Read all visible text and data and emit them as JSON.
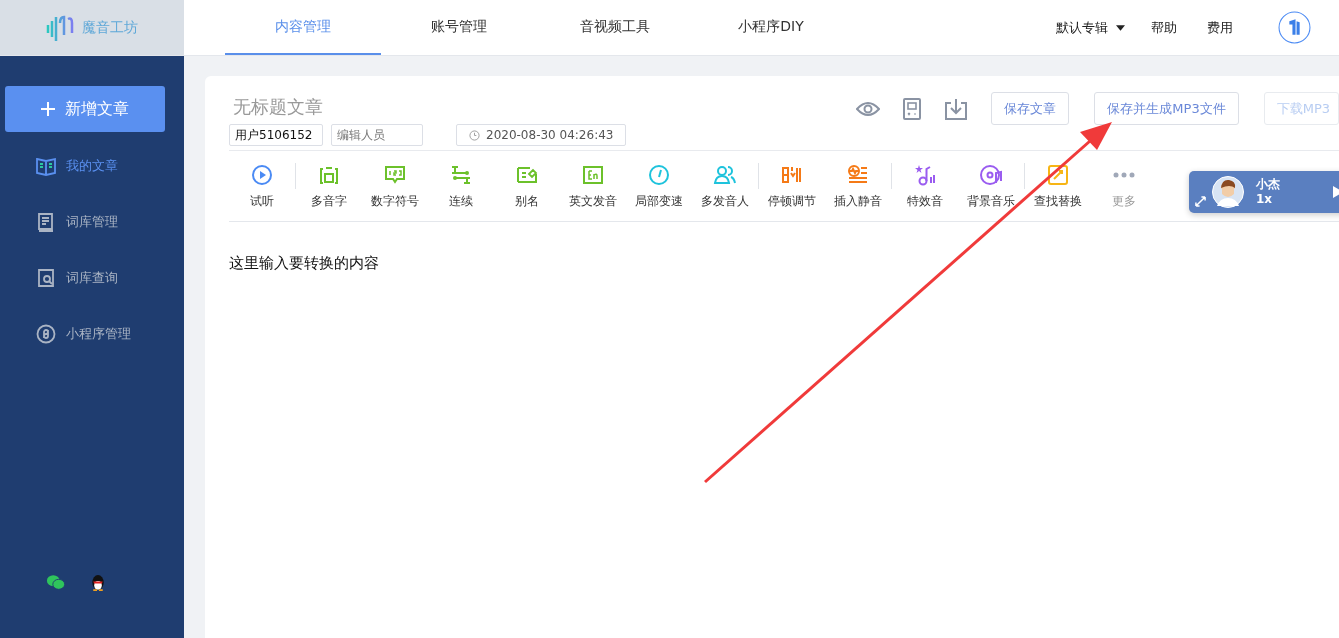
{
  "logo": {
    "text": "魔音工坊"
  },
  "nav_tabs": [
    {
      "label": "内容管理",
      "selected": true
    },
    {
      "label": "账号管理",
      "selected": false
    },
    {
      "label": "音视频工具",
      "selected": false
    },
    {
      "label": "小程序DIY",
      "selected": false
    }
  ],
  "header_right": {
    "album": "默认专辑",
    "links": [
      "帮助",
      "费用"
    ]
  },
  "sidebar": {
    "new_button": "新增文章",
    "items": [
      {
        "label": "我的文章",
        "selected": true
      },
      {
        "label": "词库管理",
        "selected": false
      },
      {
        "label": "词库查询",
        "selected": false
      },
      {
        "label": "小程序管理",
        "selected": false
      }
    ]
  },
  "article": {
    "title_placeholder": "无标题文章",
    "author": "用户5106152",
    "editor_placeholder": "编辑人员",
    "date": "2020-08-30 04:26:43",
    "buttons": [
      {
        "label": "保存文章",
        "disabled": false
      },
      {
        "label": "保存并生成MP3文件",
        "disabled": false
      },
      {
        "label": "下载MP3",
        "disabled": true
      }
    ]
  },
  "tool_groups": [
    {
      "tools": [
        {
          "label": "试听",
          "color": "#4a8af4"
        }
      ]
    },
    {
      "tools": [
        {
          "label": "多音字",
          "color": "#6cc12b"
        },
        {
          "label": "数字符号",
          "color": "#6cc12b"
        },
        {
          "label": "连续",
          "color": "#6cc12b"
        },
        {
          "label": "别名",
          "color": "#6cc12b"
        },
        {
          "label": "英文发音",
          "color": "#6cc12b"
        },
        {
          "label": "局部变速",
          "color": "#1ec3dc"
        },
        {
          "label": "多发音人",
          "color": "#1ec3dc"
        }
      ]
    },
    {
      "tools": [
        {
          "label": "停顿调节",
          "color": "#f57a17"
        },
        {
          "label": "插入静音",
          "color": "#f57a17"
        }
      ]
    },
    {
      "tools": [
        {
          "label": "特效音",
          "color": "#9a5cf0"
        },
        {
          "label": "背景音乐",
          "color": "#9a5cf0"
        }
      ]
    },
    {
      "tools": [
        {
          "label": "查找替换",
          "color": "#f7b515"
        },
        {
          "label": "更多",
          "color": "#a0a8b8"
        }
      ]
    }
  ],
  "voice": {
    "name": "小杰",
    "speed": "1x"
  },
  "editor": {
    "text": "这里输入要转换的内容"
  }
}
